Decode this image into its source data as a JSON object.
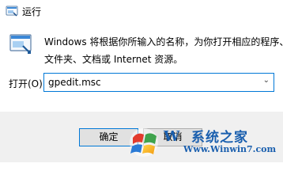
{
  "window": {
    "title": "运行"
  },
  "description": {
    "line1": "Windows 将根据你所输入的名称，为你打开相应的程序、",
    "line2": "文件夹、文档或 Internet 资源。"
  },
  "open_field": {
    "label": "打开(O):",
    "value": "gpedit.msc"
  },
  "buttons": {
    "ok": "确定",
    "cancel": "取消"
  },
  "watermark": {
    "text1": "系统之家",
    "text2": "Www.Winwin7.com"
  },
  "colors": {
    "accent": "#0078d7",
    "footer_bg": "#f0f0f0",
    "watermark": "#1a5fae"
  }
}
